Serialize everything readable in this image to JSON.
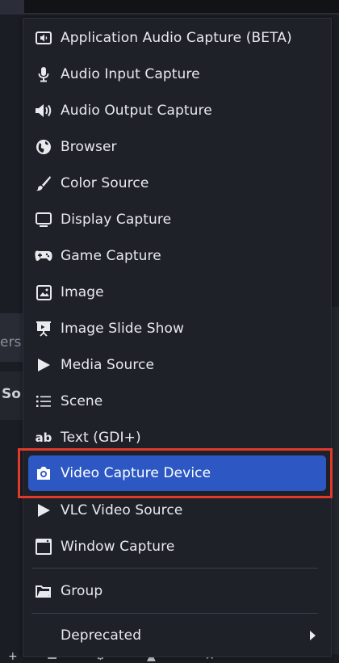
{
  "menu": {
    "items": [
      {
        "label": "Application Audio Capture (BETA)",
        "icon": "app-audio-icon"
      },
      {
        "label": "Audio Input Capture",
        "icon": "microphone-icon"
      },
      {
        "label": "Audio Output Capture",
        "icon": "speaker-icon"
      },
      {
        "label": "Browser",
        "icon": "globe-icon"
      },
      {
        "label": "Color Source",
        "icon": "paintbrush-icon"
      },
      {
        "label": "Display Capture",
        "icon": "monitor-icon"
      },
      {
        "label": "Game Capture",
        "icon": "gamepad-icon"
      },
      {
        "label": "Image",
        "icon": "image-icon"
      },
      {
        "label": "Image Slide Show",
        "icon": "slideshow-icon"
      },
      {
        "label": "Media Source",
        "icon": "play-icon"
      },
      {
        "label": "Scene",
        "icon": "list-icon"
      },
      {
        "label": "Text (GDI+)",
        "icon": "text-ab-icon"
      },
      {
        "label": "Video Capture Device",
        "icon": "camera-icon",
        "selected": true
      },
      {
        "label": "VLC Video Source",
        "icon": "vlc-play-icon"
      },
      {
        "label": "Window Capture",
        "icon": "window-icon"
      },
      {
        "label": "Group",
        "icon": "folder-icon"
      },
      {
        "label": "Deprecated",
        "icon": "",
        "submenu": true
      }
    ],
    "icon_text": {
      "text": "ab"
    }
  },
  "background": {
    "fragment_1": "ers",
    "fragment_2": "So"
  },
  "colors": {
    "selected": "#2d58c4",
    "highlight_box": "#e03a2a"
  }
}
